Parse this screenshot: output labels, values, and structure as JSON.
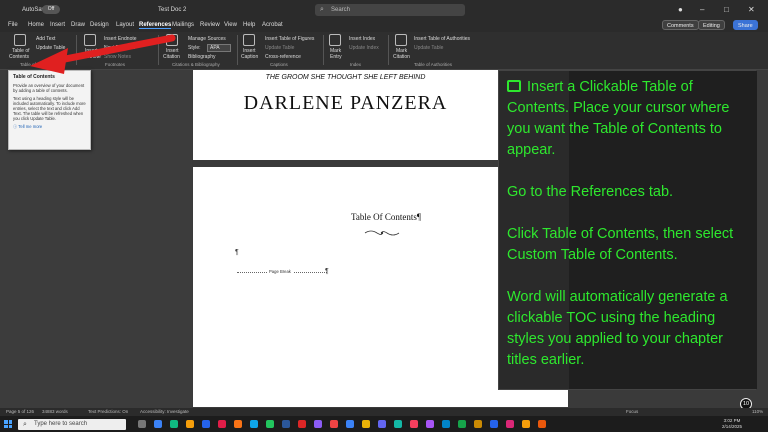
{
  "titlebar": {
    "autosave_label": "AutoSave",
    "autosave_state": "Off",
    "doc_name": "Test Doc 2",
    "search_placeholder": "Search"
  },
  "tabs": [
    "File",
    "Home",
    "Insert",
    "Draw",
    "Design",
    "Layout",
    "References",
    "Mailings",
    "Review",
    "View",
    "Help",
    "Acrobat"
  ],
  "active_tab": "References",
  "right_buttons": {
    "comments": "Comments",
    "editing": "Editing",
    "share": "Share"
  },
  "ribbon": {
    "toc_label_1": "Table of",
    "toc_label_2": "Contents",
    "add_text": "Add Text",
    "update_table": "Update Table",
    "insert_footnote_1": "Insert",
    "insert_footnote_2": "Footnote",
    "insert_endnote": "Insert Endnote",
    "next_footnote": "Next Footnote",
    "show_notes": "Show Notes",
    "insert_citation_1": "Insert",
    "insert_citation_2": "Citation",
    "manage_sources": "Manage Sources",
    "style_label": "Style:",
    "style_value": "APA",
    "bibliography": "Bibliography",
    "insert_caption_1": "Insert",
    "insert_caption_2": "Caption",
    "insert_table_figures": "Insert Table of Figures",
    "update_table_2": "Update Table",
    "cross_reference": "Cross-reference",
    "mark_entry_1": "Mark",
    "mark_entry_2": "Entry",
    "insert_index": "Insert Index",
    "update_index": "Update Index",
    "mark_citation_1": "Mark",
    "mark_citation_2": "Citation",
    "insert_table_authorities": "Insert Table of Authorities",
    "update_table_3": "Update Table",
    "groups": {
      "toc": "Table of Contents",
      "footnotes": "Footnotes",
      "citations": "Citations & Bibliography",
      "captions": "Captions",
      "index": "Index",
      "authorities": "Table of Authorities"
    }
  },
  "tooltip": {
    "title": "Table of Contents",
    "p1": "Provide an overview of your document by adding a table of contents.",
    "p2": "Text using a heading style will be included automatically. To include more entries, select the text and click Add Text. The table will be refreshed when you click Update Table.",
    "more": "Tell me more"
  },
  "document": {
    "subtitle": "THE GROOM SHE THOUGHT SHE LEFT BEHIND",
    "author": "DARLENE PANZERA",
    "toc_heading": "Table Of Contents¶",
    "pilcrow": "¶",
    "page_break": "Page Break",
    "pilcrow2": "¶"
  },
  "overlay": {
    "p1": "Insert a Clickable Table of Contents. Place your cursor where you want the Table of Contents to appear.",
    "p2": "Go to the References tab.",
    "p3": "Click Table of Contents, then select Custom Table of Contents.",
    "p4": "Word will automatically generate a clickable TOC using the heading styles you applied to your chapter titles earlier."
  },
  "badge": "10",
  "status": {
    "page": "Page 5 of 126",
    "words": "34883 words",
    "predictions": "Text Predictions: On",
    "accessibility": "Accessibility: Investigate",
    "focus": "Focus",
    "zoom": "110%"
  },
  "taskbar": {
    "search_placeholder": "Type here to search",
    "time": "3:02 PM",
    "date": "2/14/2025"
  },
  "colors": {
    "overlay_text": "#2ee82e",
    "arrow": "#e02020"
  }
}
